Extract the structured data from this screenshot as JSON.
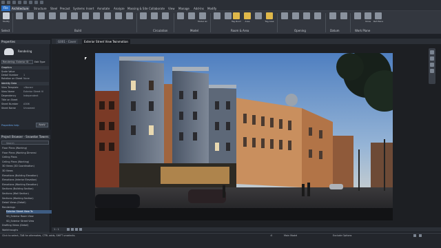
{
  "tabs": [
    "File",
    "Architecture",
    "Structure",
    "Steel",
    "Precast",
    "Systems",
    "Insert",
    "Annotate",
    "Analyze",
    "Massing & Site",
    "Collaborate",
    "View",
    "Manage",
    "Add-Ins",
    "Modify"
  ],
  "active_tab": "Architecture",
  "ribbon": {
    "select_label": "Select",
    "modify_label": "Modify",
    "groups": [
      "Build",
      "Circulation",
      "Model",
      "Room & Area",
      "Opening",
      "Datum",
      "Work Plane"
    ],
    "buttons": [
      "Tag Room",
      "Area",
      "Tag Area",
      "Show",
      "Ref Plane",
      "Model Group"
    ]
  },
  "properties": {
    "title": "Properties",
    "type_name": "Rendering",
    "selector": "Rendering: Exterior St",
    "edit_type": "Edit Type",
    "section_graphics": "Graphics",
    "rows": [
      {
        "label": "Scale Value",
        "value": ""
      },
      {
        "label": "Detail Number",
        "value": "1"
      },
      {
        "label": "Rotation on Sheet",
        "value": "None"
      }
    ],
    "section_identity": "Identity Data",
    "identity_rows": [
      {
        "label": "View Template",
        "value": "<None>"
      },
      {
        "label": "View Name",
        "value": "Exterior Street Vi"
      },
      {
        "label": "Dependency",
        "value": "Independent"
      },
      {
        "label": "Title on Sheet",
        "value": ""
      },
      {
        "label": "Sheet Number",
        "value": "A306"
      },
      {
        "label": "Sheet Name",
        "value": "Unnamed"
      }
    ],
    "help_link": "Properties help",
    "apply": "Apply"
  },
  "browser": {
    "title": "Project Browser - Snowdon Towers",
    "search_placeholder": "Search",
    "items": [
      "Floor Plans (Working)",
      "Floor Plans (Working Dimensi",
      "Ceiling Plans",
      "Ceiling Plans (Working)",
      "3D Views (3D Coordination)",
      "3D Views",
      "Elevations (Building Elevation)",
      "Elevations (Interior Elevation)",
      "Elevations (Working Elevation)",
      "Sections (Building Section)",
      "Sections (Wall Section)",
      "Sections (Working Section)",
      "Detail Views (Detail)",
      "Renderings",
      "Exterior Street View To",
      "SD_Exterior Room View",
      "SD_Exterior Street View",
      "Drafting Views (Detail)",
      "Walkthroughs"
    ],
    "selected_index": 14
  },
  "view_tabs": [
    "G001 - Cover",
    "Exterior Street View Twinmotion"
  ],
  "active_view_tab": 1,
  "view_control": {
    "scale": "1 : 1"
  },
  "status": {
    "hint": "Click to select, TAB for alternates, CTRL adds, SHIFT unselects.",
    "model": "Main Model",
    "zero": ":0",
    "exclude": "Exclude Options"
  }
}
